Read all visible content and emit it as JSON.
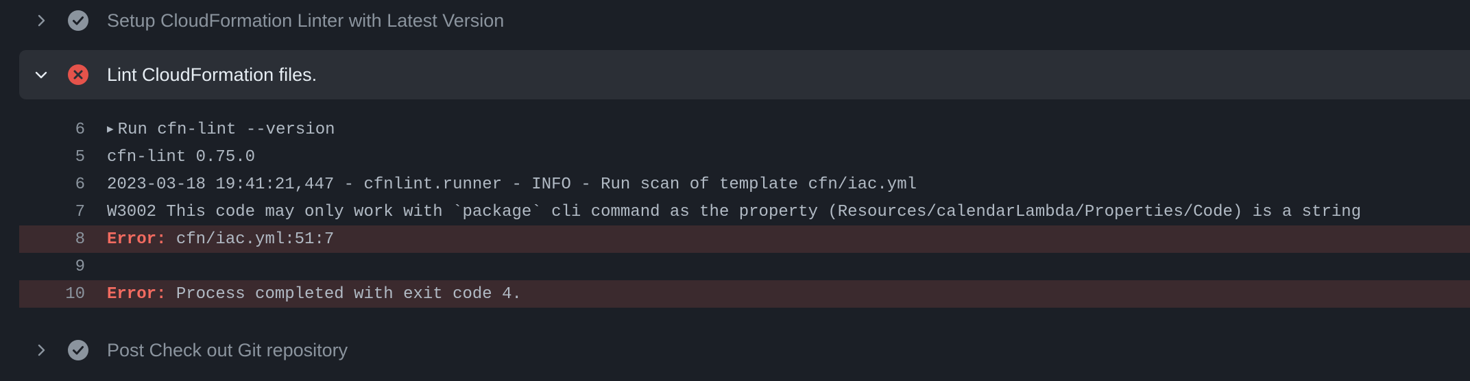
{
  "steps": {
    "setup_lint": {
      "title": "Setup CloudFormation Linter with Latest Version",
      "status": "success",
      "expanded": false,
      "icon": "check-circle-icon",
      "chevron": "chevron-right-icon"
    },
    "lint_files": {
      "title": "Lint CloudFormation files.",
      "status": "failure",
      "expanded": true,
      "icon": "x-circle-icon",
      "chevron": "chevron-down-icon"
    },
    "post_checkout": {
      "title": "Post Check out Git repository",
      "status": "success",
      "expanded": false,
      "icon": "check-circle-icon",
      "chevron": "chevron-right-icon"
    }
  },
  "log": {
    "lines": [
      {
        "num": "6",
        "text": "Run cfn-lint --version",
        "group": true
      },
      {
        "num": "5",
        "text": "cfn-lint 0.75.0"
      },
      {
        "num": "6",
        "text": "2023-03-18 19:41:21,447 - cfnlint.runner - INFO - Run scan of template cfn/iac.yml"
      },
      {
        "num": "7",
        "text": "W3002 This code may only work with `package` cli command as the property (Resources/calendarLambda/Properties/Code) is a string"
      },
      {
        "num": "8",
        "label": "Error:",
        "text": " cfn/iac.yml:51:7",
        "error": true
      },
      {
        "num": "9",
        "text": ""
      },
      {
        "num": "10",
        "label": "Error:",
        "text": " Process completed with exit code 4.",
        "error": true
      }
    ]
  },
  "colors": {
    "background": "#1b1f26",
    "expanded_step_bg": "#2b2f36",
    "error_row_bg": "#3b2a2e",
    "error_text": "#f26b60",
    "success_icon": "#8b949e",
    "failure_icon": "#e5534b"
  }
}
